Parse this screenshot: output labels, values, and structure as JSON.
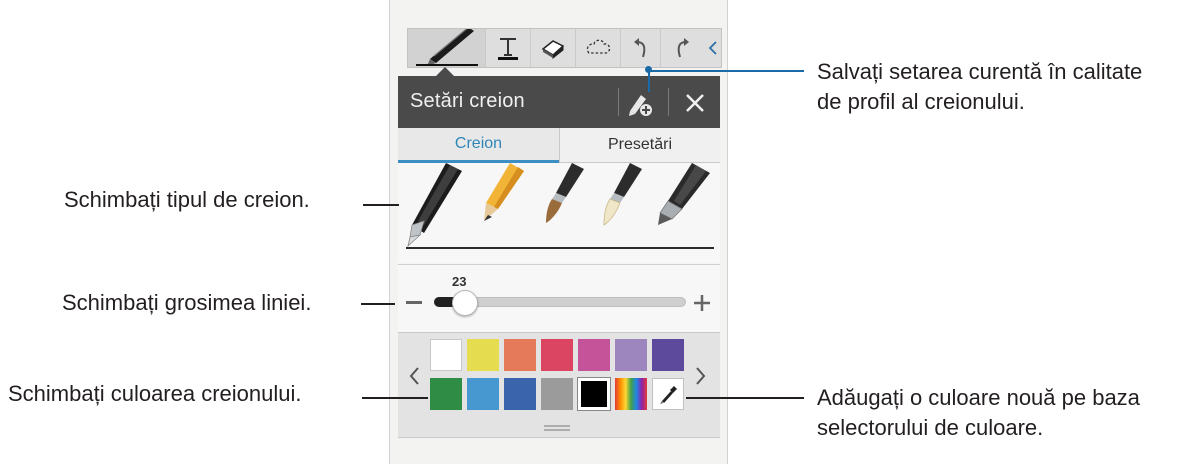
{
  "toolbar": {
    "tools": [
      "pen-tool",
      "text-tool",
      "eraser-tool",
      "lasso-tool",
      "undo",
      "redo",
      "collapse"
    ]
  },
  "panel": {
    "title": "Setări creion",
    "tabs": [
      {
        "label": "Creion",
        "selected": true
      },
      {
        "label": "Presetări",
        "selected": false
      }
    ],
    "pen_types": [
      "ballpoint-pen",
      "pencil",
      "brush",
      "calligraphy-brush",
      "marker"
    ],
    "thickness": {
      "value": "23",
      "level": 0.1
    },
    "colors": [
      [
        "#ffffff",
        "#e6dc4f",
        "#e57a5b",
        "#dc4561",
        "#c4539a",
        "#9c86bd",
        "#5e4a9d"
      ],
      [
        "#2e8c45",
        "#4797d1",
        "#3a65ad",
        "#9b9b9b",
        "#000000",
        "spectrum",
        "eyedropper"
      ]
    ],
    "selected_color": "#000000"
  },
  "callouts": {
    "save_profile": "Salvați setarea curentă în calitate\nde profil al creionului.",
    "save_line1": "Salvați setarea curentă în calitate",
    "save_line2": "de profil al creionului.",
    "pen_type": "Schimbați tipul de creion.",
    "line_thickness": "Schimbați grosimea liniei.",
    "pen_color": "Schimbați culoarea creionului.",
    "picker_line1": "Adăugați o culoare nouă pe baza",
    "picker_line2": "selectorului de culoare."
  },
  "colors": {
    "accent": "#3c8fc4",
    "callout_dot": "#1a6aa8",
    "header": "#4a4a4a"
  }
}
